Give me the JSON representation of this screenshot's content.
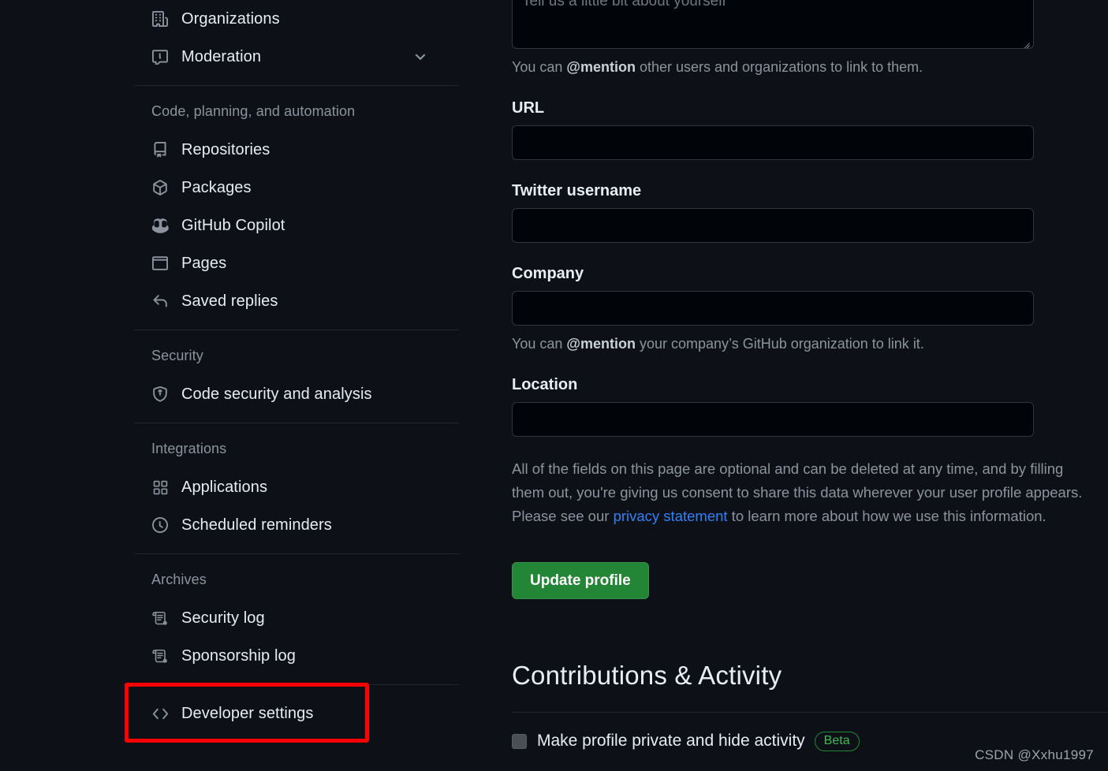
{
  "sidebar": {
    "groups": [
      {
        "heading": null,
        "items": [
          {
            "label": "Organizations",
            "icon": "organization-icon",
            "chevron": false
          },
          {
            "label": "Moderation",
            "icon": "report-icon",
            "chevron": true
          }
        ]
      },
      {
        "heading": "Code, planning, and automation",
        "items": [
          {
            "label": "Repositories",
            "icon": "repo-icon",
            "chevron": false
          },
          {
            "label": "Packages",
            "icon": "package-icon",
            "chevron": false
          },
          {
            "label": "GitHub Copilot",
            "icon": "copilot-icon",
            "chevron": false
          },
          {
            "label": "Pages",
            "icon": "browser-icon",
            "chevron": false
          },
          {
            "label": "Saved replies",
            "icon": "reply-icon",
            "chevron": false
          }
        ]
      },
      {
        "heading": "Security",
        "items": [
          {
            "label": "Code security and analysis",
            "icon": "shield-lock-icon",
            "chevron": false
          }
        ]
      },
      {
        "heading": "Integrations",
        "items": [
          {
            "label": "Applications",
            "icon": "apps-grid-icon",
            "chevron": false
          },
          {
            "label": "Scheduled reminders",
            "icon": "clock-icon",
            "chevron": false
          }
        ]
      },
      {
        "heading": "Archives",
        "items": [
          {
            "label": "Security log",
            "icon": "log-scroll-icon",
            "chevron": false
          },
          {
            "label": "Sponsorship log",
            "icon": "log-scroll-icon",
            "chevron": false
          }
        ]
      },
      {
        "heading": null,
        "items": [
          {
            "label": "Developer settings",
            "icon": "code-brackets-icon",
            "chevron": false,
            "highlighted": true
          }
        ]
      }
    ]
  },
  "main": {
    "bio": {
      "placeholder": "Tell us a little bit about yourself",
      "value": "",
      "help_prefix": "You can ",
      "help_mention": "@mention",
      "help_suffix": " other users and organizations to link to them."
    },
    "url": {
      "label": "URL",
      "value": "",
      "placeholder": ""
    },
    "twitter": {
      "label": "Twitter username",
      "value": "",
      "placeholder": ""
    },
    "company": {
      "label": "Company",
      "value": "",
      "placeholder": "",
      "help_prefix": "You can ",
      "help_mention": "@mention",
      "help_suffix": " your company’s GitHub organization to link it."
    },
    "location": {
      "label": "Location",
      "value": "",
      "placeholder": ""
    },
    "consent": {
      "text_before_link": "All of the fields on this page are optional and can be deleted at any time, and by filling them out, you're giving us consent to share this data wherever your user profile appears. Please see our ",
      "link_text": "privacy statement",
      "text_after_link": " to learn more about how we use this information."
    },
    "update_button": "Update profile",
    "contributions": {
      "title": "Contributions & Activity",
      "private_profile_label": "Make profile private and hide activity",
      "beta_badge": "Beta"
    }
  },
  "watermark": "CSDN @Xxhu1997",
  "colors": {
    "page_bg": "#0d1117",
    "input_bg": "#010409",
    "border": "#30363d",
    "accent_green": "#238636",
    "link_blue": "#2f81f7",
    "beta_green": "#3fb950",
    "annotation_red": "#ff0000",
    "muted_text": "#8b949e"
  }
}
